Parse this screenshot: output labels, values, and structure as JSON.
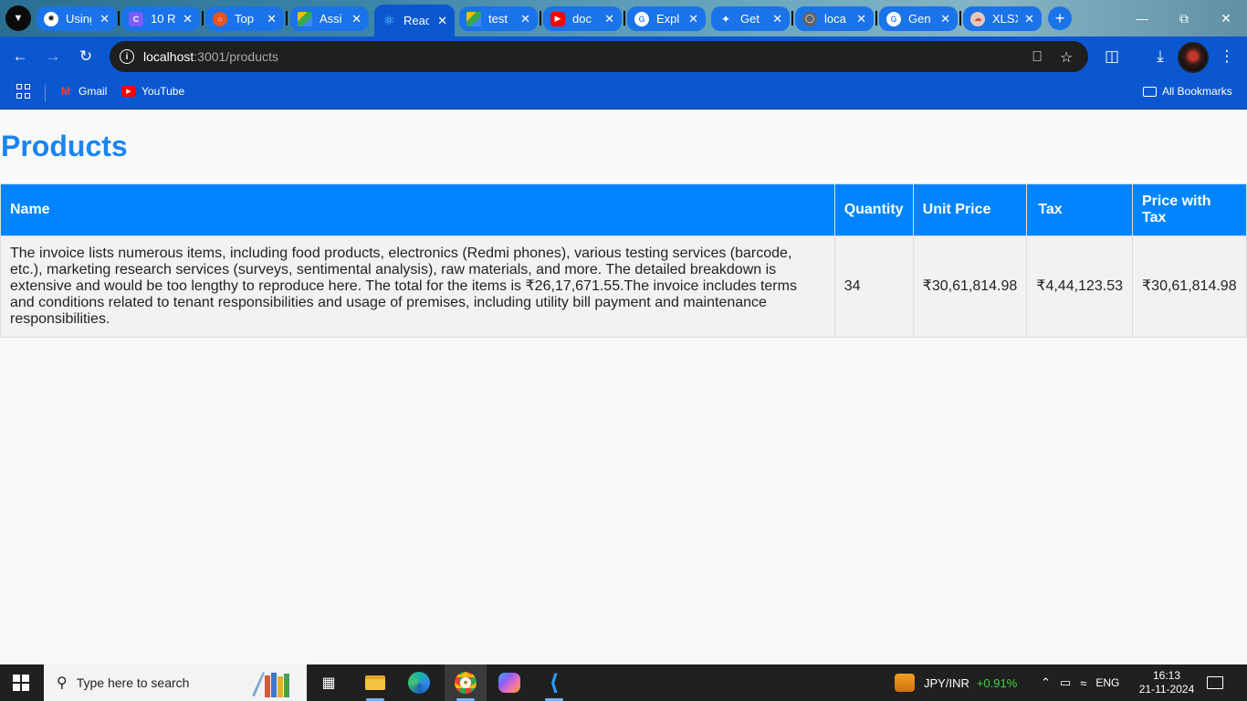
{
  "browser": {
    "tabs": [
      {
        "title": "Using",
        "icon": "openai-icon",
        "color": "#10a37f"
      },
      {
        "title": "10 R",
        "icon": "c-icon",
        "color": "#7c5cff"
      },
      {
        "title": "Top",
        "icon": "ubuntu-icon",
        "color": "#e95420"
      },
      {
        "title": "Assi",
        "icon": "drive-icon",
        "color": "#34a853"
      },
      {
        "title": "Reac",
        "icon": "react-icon",
        "color": "#61dafb",
        "active": true
      },
      {
        "title": "test",
        "icon": "drive-icon",
        "color": "#34a853"
      },
      {
        "title": "doc",
        "icon": "youtube-icon",
        "color": "#ff0000"
      },
      {
        "title": "Expl",
        "icon": "google-icon",
        "color": "#4285f4"
      },
      {
        "title": "Get",
        "icon": "tools-icon",
        "color": "#ffffff"
      },
      {
        "title": "loca",
        "icon": "globe-icon",
        "color": "#5f6368"
      },
      {
        "title": "Gen",
        "icon": "google-icon",
        "color": "#4285f4"
      },
      {
        "title": "XLSX",
        "icon": "xlsx-icon",
        "color": "#c0504d"
      }
    ],
    "url_host": "localhost",
    "url_path": ":3001/products",
    "bookmarks": [
      {
        "label": "Gmail",
        "icon": "gmail-icon"
      },
      {
        "label": "YouTube",
        "icon": "youtube-icon"
      }
    ],
    "all_bookmarks": "All Bookmarks"
  },
  "page": {
    "title": "Products",
    "columns": [
      "Name",
      "Quantity",
      "Unit Price",
      "Tax",
      "Price with Tax"
    ],
    "rows": [
      {
        "name": "The invoice lists numerous items, including food products, electronics (Redmi phones), various testing services (barcode, etc.), marketing research services (surveys, sentimental analysis), raw materials, and more. The detailed breakdown is extensive and would be too lengthy to reproduce here. The total for the items is ₹26,17,671.55.The invoice includes terms and conditions related to tenant responsibilities and usage of premises, including utility bill payment and maintenance responsibilities.",
        "quantity": "34",
        "unit_price": "₹30,61,814.98",
        "tax": "₹4,44,123.53",
        "price_with_tax": "₹30,61,814.98"
      }
    ]
  },
  "taskbar": {
    "search_placeholder": "Type here to search",
    "ticker_label": "JPY/INR",
    "ticker_change": "+0.91%",
    "language": "ENG",
    "time": "16:13",
    "date": "21-11-2024"
  },
  "colors": {
    "accent": "#0084ff",
    "title": "#1a85f0",
    "browser_chrome": "#0b57d0",
    "ticker_positive": "#3fd13f"
  }
}
